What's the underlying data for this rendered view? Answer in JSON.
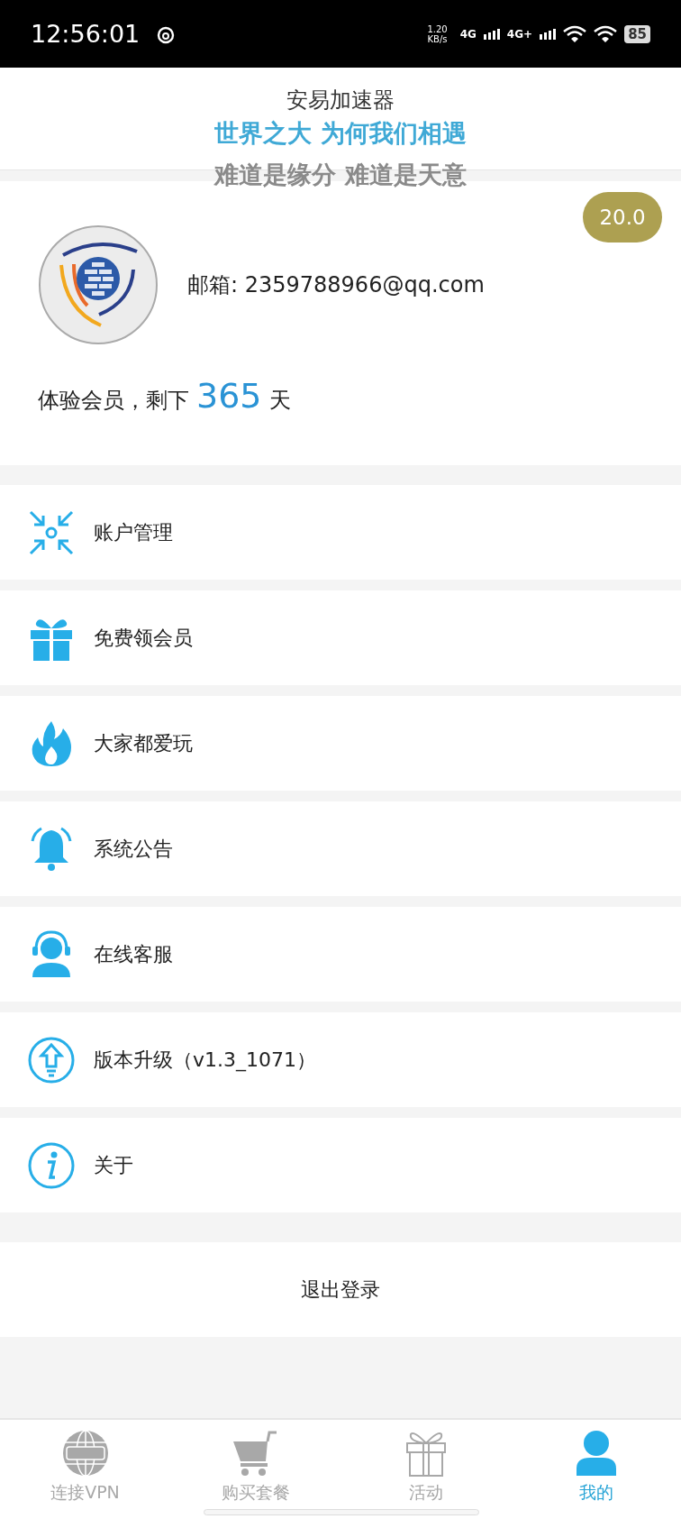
{
  "status_bar": {
    "time": "12:56:01",
    "speed_value": "1.20",
    "speed_unit": "KB/s",
    "networks": [
      "4G",
      "4G+"
    ],
    "battery": "85"
  },
  "header": {
    "title": "安易加速器"
  },
  "lyrics_overlay": {
    "lines": [
      {
        "text": "世界之大 为何我们相遇",
        "kind": "current"
      },
      {
        "text": "难道是缘分 难道是天意",
        "kind": "next"
      }
    ]
  },
  "profile": {
    "balance": "20.0",
    "email": "邮箱: 2359788966@qq.com",
    "membership_label": "体验会员，剩下",
    "days": "365",
    "days_unit": "天"
  },
  "menu": [
    {
      "label": "账户管理",
      "kind": "account"
    },
    {
      "label": "免费领会员",
      "kind": "gift"
    },
    {
      "label": "大家都爱玩",
      "kind": "fire"
    },
    {
      "label": "系统公告",
      "kind": "bell"
    },
    {
      "label": "在线客服",
      "kind": "support"
    },
    {
      "label": "版本升级（v1.3_1071）",
      "kind": "upgrade"
    },
    {
      "label": "关于",
      "kind": "info"
    }
  ],
  "logout": {
    "label": "退出登录"
  },
  "tabs": [
    {
      "label": "连接VPN",
      "kind": "vpn",
      "selected": false
    },
    {
      "label": "购买套餐",
      "kind": "cart",
      "selected": false
    },
    {
      "label": "活动",
      "kind": "gift",
      "selected": false
    },
    {
      "label": "我的",
      "kind": "user",
      "selected": true
    }
  ]
}
